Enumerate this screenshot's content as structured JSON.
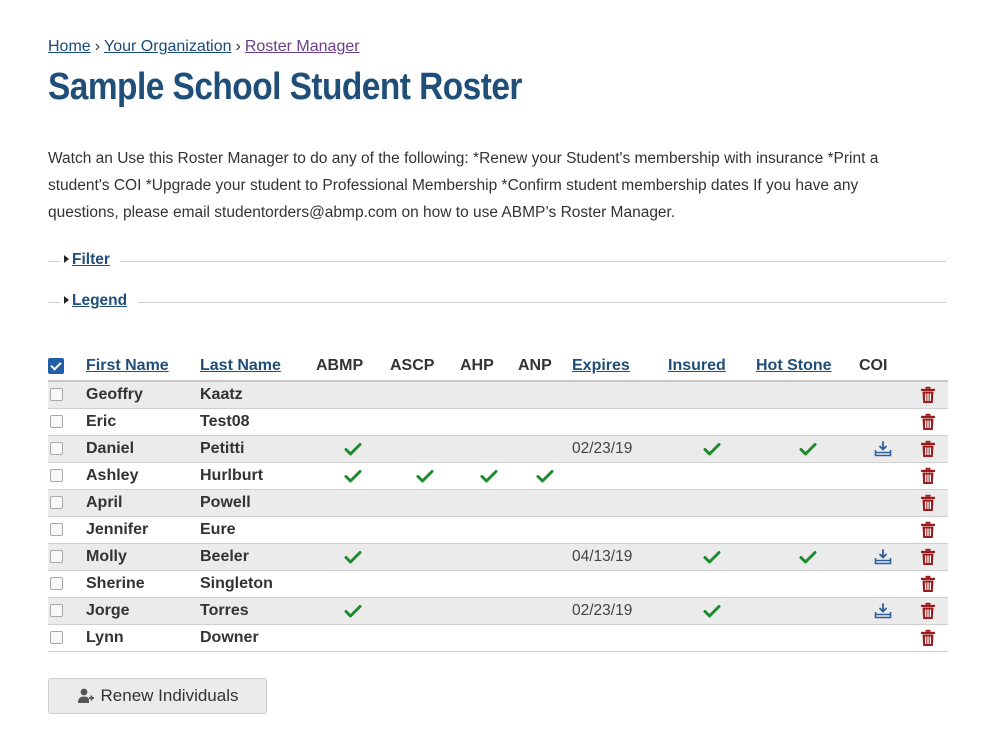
{
  "breadcrumb": {
    "home": "Home",
    "separator": "›",
    "organization": "Your Organization",
    "current": "Roster Manager"
  },
  "page_title": "Sample School Student Roster",
  "intro": "Watch an Use this Roster Manager to do any of the following: *Renew your Student's membership with insurance *Print a student's COI *Upgrade your student to Professional Membership *Confirm student membership dates If you have any questions, please email studentorders@abmp.com on how to use ABMP’s Roster Manager.",
  "filter_label": "Filter",
  "legend_label": "Legend",
  "table": {
    "headers": {
      "first_name": "First Name",
      "last_name": "Last Name",
      "abmp": "ABMP",
      "ascp": "ASCP",
      "ahp": "AHP",
      "anp": "ANP",
      "expires": "Expires",
      "insured": "Insured",
      "hot_stone": "Hot Stone",
      "coi": "COI"
    },
    "rows": [
      {
        "first": "Geoffry",
        "last": "Kaatz",
        "abmp": false,
        "ascp": false,
        "ahp": false,
        "anp": false,
        "expires": "",
        "insured": false,
        "hot_stone": false,
        "coi": false
      },
      {
        "first": "Eric",
        "last": "Test08",
        "abmp": false,
        "ascp": false,
        "ahp": false,
        "anp": false,
        "expires": "",
        "insured": false,
        "hot_stone": false,
        "coi": false
      },
      {
        "first": "Daniel",
        "last": "Petitti",
        "abmp": true,
        "ascp": false,
        "ahp": false,
        "anp": false,
        "expires": "02/23/19",
        "insured": true,
        "hot_stone": true,
        "coi": true
      },
      {
        "first": "Ashley",
        "last": "Hurlburt",
        "abmp": true,
        "ascp": true,
        "ahp": true,
        "anp": true,
        "expires": "",
        "insured": false,
        "hot_stone": false,
        "coi": false
      },
      {
        "first": "April",
        "last": "Powell",
        "abmp": false,
        "ascp": false,
        "ahp": false,
        "anp": false,
        "expires": "",
        "insured": false,
        "hot_stone": false,
        "coi": false
      },
      {
        "first": "Jennifer",
        "last": "Eure",
        "abmp": false,
        "ascp": false,
        "ahp": false,
        "anp": false,
        "expires": "",
        "insured": false,
        "hot_stone": false,
        "coi": false
      },
      {
        "first": "Molly",
        "last": "Beeler",
        "abmp": true,
        "ascp": false,
        "ahp": false,
        "anp": false,
        "expires": "04/13/19",
        "insured": true,
        "hot_stone": true,
        "coi": true
      },
      {
        "first": "Sherine",
        "last": "Singleton",
        "abmp": false,
        "ascp": false,
        "ahp": false,
        "anp": false,
        "expires": "",
        "insured": false,
        "hot_stone": false,
        "coi": false
      },
      {
        "first": "Jorge",
        "last": "Torres",
        "abmp": true,
        "ascp": false,
        "ahp": false,
        "anp": false,
        "expires": "02/23/19",
        "insured": true,
        "hot_stone": false,
        "coi": true
      },
      {
        "first": "Lynn",
        "last": "Downer",
        "abmp": false,
        "ascp": false,
        "ahp": false,
        "anp": false,
        "expires": "",
        "insured": false,
        "hot_stone": false,
        "coi": false
      }
    ]
  },
  "renew_button": "Renew Individuals",
  "icons": {
    "check": "checkmark-icon",
    "coi": "download-coi-icon",
    "delete": "trash-icon",
    "renew": "user-renew-icon"
  },
  "colors": {
    "title": "#1f4e79",
    "link": "#1a4a7a",
    "check": "#1e8a2e",
    "trash": "#9b1c1c",
    "coi_icon": "#2d5f9a",
    "row_stripe": "#ebebeb"
  }
}
